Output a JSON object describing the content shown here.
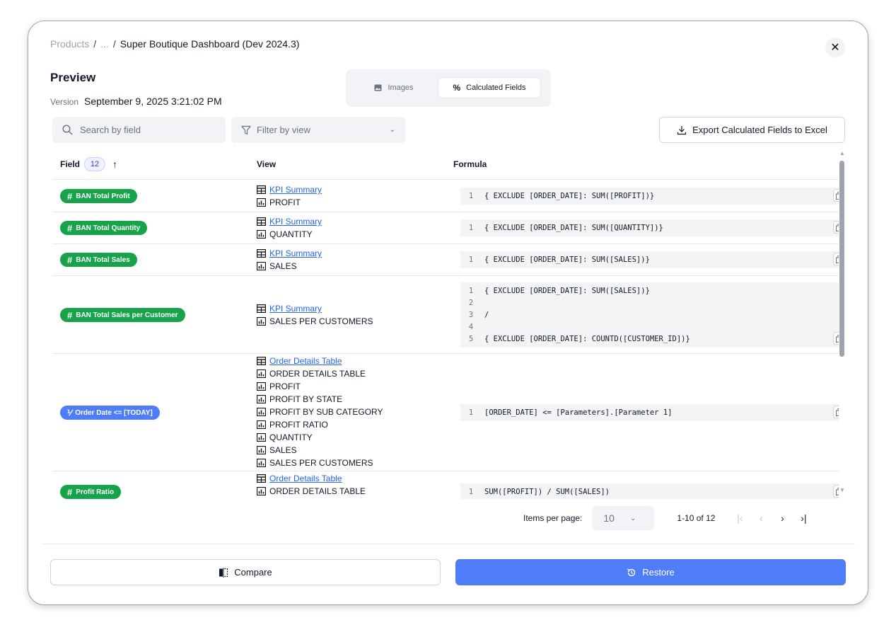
{
  "breadcrumb": {
    "root": "Products",
    "separator": "/",
    "ellipsis": "...",
    "current": "Super Boutique Dashboard (Dev 2024.3)"
  },
  "title": "Preview",
  "version": {
    "label": "Version",
    "value": "September 9,  2025 3:21:02 PM"
  },
  "tabs": {
    "images": "Images",
    "calculated": "Calculated Fields",
    "active": "Calculated Fields"
  },
  "search": {
    "placeholder": "Search by field"
  },
  "filter": {
    "placeholder": "Filter by view"
  },
  "export_label": "Export Calculated Fields to Excel",
  "table": {
    "headers": {
      "field": "Field",
      "count": "12",
      "view": "View",
      "formula": "Formula"
    },
    "rows": [
      {
        "field": "BAN Total Profit",
        "type": "number",
        "views": [
          {
            "kind": "dashboard",
            "label": "KPI Summary"
          },
          {
            "kind": "sheet",
            "label": "PROFIT"
          }
        ],
        "formula": [
          "{ EXCLUDE [ORDER_DATE]: SUM([PROFIT])}"
        ]
      },
      {
        "field": "BAN Total Quantity",
        "type": "number",
        "views": [
          {
            "kind": "dashboard",
            "label": "KPI Summary"
          },
          {
            "kind": "sheet",
            "label": "QUANTITY"
          }
        ],
        "formula": [
          "{ EXCLUDE [ORDER_DATE]: SUM([QUANTITY])}"
        ]
      },
      {
        "field": "BAN Total Sales",
        "type": "number",
        "views": [
          {
            "kind": "dashboard",
            "label": "KPI Summary"
          },
          {
            "kind": "sheet",
            "label": "SALES"
          }
        ],
        "formula": [
          "{ EXCLUDE [ORDER_DATE]: SUM([SALES])}"
        ]
      },
      {
        "field": "BAN Total Sales per Customer",
        "type": "number",
        "views": [
          {
            "kind": "dashboard",
            "label": "KPI Summary"
          },
          {
            "kind": "sheet",
            "label": "SALES PER CUSTOMERS"
          }
        ],
        "formula": [
          "{ EXCLUDE [ORDER_DATE]: SUM([SALES])}",
          "",
          "/",
          "",
          "{ EXCLUDE [ORDER_DATE]: COUNTD([CUSTOMER_ID])}"
        ]
      },
      {
        "field": "Order Date <= [TODAY]",
        "type": "boolean",
        "views": [
          {
            "kind": "dashboard",
            "label": "Order Details Table"
          },
          {
            "kind": "sheet",
            "label": "ORDER DETAILS TABLE"
          },
          {
            "kind": "sheet",
            "label": "PROFIT"
          },
          {
            "kind": "sheet",
            "label": "PROFIT BY STATE"
          },
          {
            "kind": "sheet",
            "label": "PROFIT BY SUB CATEGORY"
          },
          {
            "kind": "sheet",
            "label": "PROFIT RATIO"
          },
          {
            "kind": "sheet",
            "label": "QUANTITY"
          },
          {
            "kind": "sheet",
            "label": "SALES"
          },
          {
            "kind": "sheet",
            "label": "SALES PER CUSTOMERS"
          }
        ],
        "formula": [
          "[ORDER_DATE] <= [Parameters].[Parameter 1]"
        ]
      },
      {
        "field": "Profit Ratio",
        "type": "number",
        "views": [
          {
            "kind": "dashboard",
            "label": "Order Details Table"
          },
          {
            "kind": "sheet",
            "label": "ORDER DETAILS TABLE"
          }
        ],
        "formula": [
          "SUM([PROFIT]) / SUM([SALES])"
        ]
      }
    ]
  },
  "pagination": {
    "items_label": "Items per page:",
    "page_size": "10",
    "range": "1-10 of 12"
  },
  "footer": {
    "compare": "Compare",
    "restore": "Restore"
  }
}
